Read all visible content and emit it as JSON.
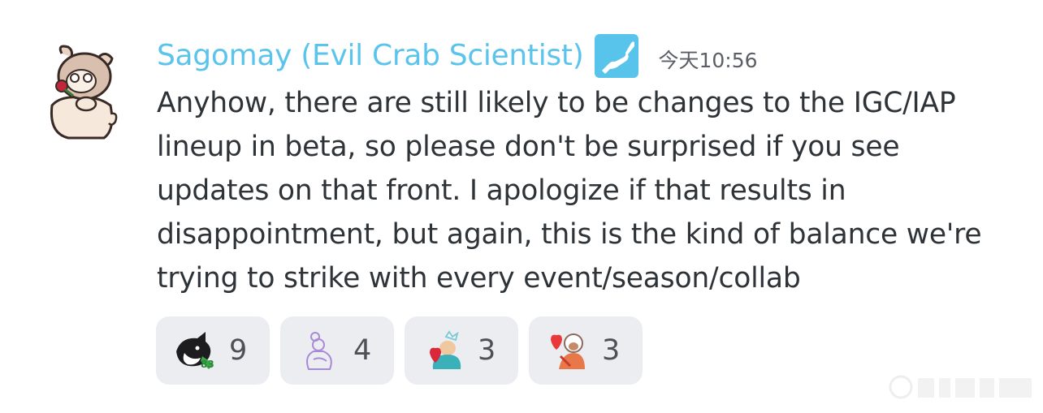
{
  "message": {
    "author": "Sagomay (Evil Crab Scientist)",
    "timestamp": "今天10:56",
    "lines": [
      "Anyhow, there are still likely to be changes to the IGC/IAP",
      "lineup in beta, so please don't be surprised if you see",
      "updates on that front. I apologize if that results in",
      "disappointment, but again, this is the kind of balance we're",
      "trying to strike with every event/season/collab"
    ]
  },
  "colors": {
    "username": "#5bc4ec",
    "reaction_bg": "#ecedf0",
    "text": "#2e3338"
  },
  "reactions": [
    {
      "emoji": "skunk-dog-emoji",
      "count": "9"
    },
    {
      "emoji": "purple-outline-figure-emoji",
      "count": "4"
    },
    {
      "emoji": "heart-character-emoji",
      "count": "3"
    },
    {
      "emoji": "character-heart-emoji",
      "count": "3"
    }
  ]
}
